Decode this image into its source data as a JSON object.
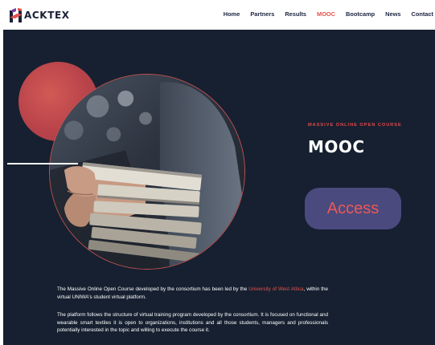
{
  "header": {
    "logo_text": "ACKTEX",
    "logo_icon": "hacktex-h-logo-icon",
    "nav": [
      {
        "label": "Home",
        "active": false
      },
      {
        "label": "Partners",
        "active": false
      },
      {
        "label": "Results",
        "active": false
      },
      {
        "label": "MOOC",
        "active": true
      },
      {
        "label": "Bootcamp",
        "active": false
      },
      {
        "label": "News",
        "active": false
      },
      {
        "label": "Contact",
        "active": false
      }
    ]
  },
  "hero": {
    "kicker": "MASSIVE ONLINE OPEN COURSE",
    "title": "MOOC",
    "access_label": "Access",
    "image": "hands-holding-stack-of-books-photo"
  },
  "description": {
    "p1_before": "The Massive Online Open Course developed by the consortium has been led by the ",
    "p1_link": "University of West Attica",
    "p1_after": ", within the virtual UNIWA's student virtual platform.",
    "p2": "The platform follows  the structure of virtual training program developed by the consortium. It is focused on functional and wearable smart textiles it is open to organizations, institutions and all those students, managers and professionals potentially interested in the topic and willing to execute the course it."
  },
  "colors": {
    "brand_dark": "#1a1f36",
    "accent_red": "#e5524f",
    "background_navy": "#162030",
    "button_purple": "#4a4a7e"
  }
}
